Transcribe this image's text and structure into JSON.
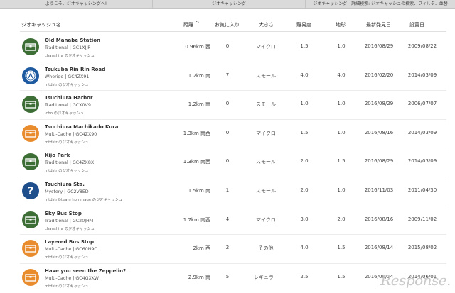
{
  "tabs": [
    {
      "label": "ようこそ、ジオキャッシングへ!"
    },
    {
      "label": "ジオキャッシング"
    },
    {
      "label": "ジオキャッシング - 詳細検索: ジオキャッシュの検索、フィルタ、並替"
    }
  ],
  "columns": {
    "name": "ジオキャッシュ名",
    "distance": "距離",
    "sort_arrow": "^",
    "favorites": "お気に入り",
    "size": "大きさ",
    "difficulty": "難易度",
    "terrain": "地形",
    "last_found": "最新発見日",
    "placed": "設置日"
  },
  "rows": [
    {
      "name": "Old Manabe Station",
      "type": "Traditional | GC1XJJP",
      "owner": "chanshira のジオキャッシュ",
      "distance": "0.96km 西",
      "favorites": "0",
      "size": "マイクロ",
      "difficulty": "1.5",
      "terrain": "1.0",
      "last_found": "2016/08/29",
      "placed": "2009/08/22",
      "icon": "traditional-icon",
      "icon_color": "#3d6e35"
    },
    {
      "name": "Tsukuba Rin Rin Road",
      "type": "Wherigo | GC4ZX91",
      "owner": "mtdstr のジオキャッシュ",
      "distance": "1.2km 南",
      "favorites": "7",
      "size": "スモール",
      "difficulty": "4.0",
      "terrain": "4.0",
      "last_found": "2016/02/20",
      "placed": "2014/03/09",
      "icon": "wherigo-icon",
      "icon_color": "#1e5aa0"
    },
    {
      "name": "Tsuchiura Harbor",
      "type": "Traditional | GCX0V9",
      "owner": "icho のジオキャッシュ",
      "distance": "1.2km 南",
      "favorites": "0",
      "size": "スモール",
      "difficulty": "1.0",
      "terrain": "1.0",
      "last_found": "2016/08/29",
      "placed": "2006/07/07",
      "icon": "traditional-icon",
      "icon_color": "#3d6e35"
    },
    {
      "name": "Tsuchiura Machikado Kura",
      "type": "Multi-Cache | GC4ZX90",
      "owner": "mtdstr のジオキャッシュ",
      "distance": "1.3km 南西",
      "favorites": "0",
      "size": "マイクロ",
      "difficulty": "1.5",
      "terrain": "1.0",
      "last_found": "2016/08/16",
      "placed": "2014/03/09",
      "icon": "multi-cache-icon",
      "icon_color": "#e98c2e"
    },
    {
      "name": "Kijo Park",
      "type": "Traditional | GC4ZX8X",
      "owner": "mtdstr のジオキャッシュ",
      "distance": "1.3km 南西",
      "favorites": "0",
      "size": "スモール",
      "difficulty": "2.0",
      "terrain": "1.5",
      "last_found": "2016/08/29",
      "placed": "2014/03/09",
      "icon": "traditional-icon",
      "icon_color": "#3d6e35"
    },
    {
      "name": "Tsuchiura Sta.",
      "type": "Mystery | GC2V8ED",
      "owner": "mtdstr@team hommage のジオキャッシュ",
      "distance": "1.5km 南",
      "favorites": "1",
      "size": "スモール",
      "difficulty": "2.0",
      "terrain": "1.0",
      "last_found": "2016/11/03",
      "placed": "2011/04/30",
      "icon": "mystery-icon",
      "icon_color": "#1e4f8c"
    },
    {
      "name": "Sky Bus Stop",
      "type": "Traditional | GC20JHM",
      "owner": "chanshira のジオキャッシュ",
      "distance": "1.7km 南西",
      "favorites": "4",
      "size": "マイクロ",
      "difficulty": "3.0",
      "terrain": "2.0",
      "last_found": "2016/08/16",
      "placed": "2009/11/02",
      "icon": "traditional-icon",
      "icon_color": "#3d6e35"
    },
    {
      "name": "Layered Bus Stop",
      "type": "Multi-Cache | GC60N9C",
      "owner": "mtdstr のジオキャッシュ",
      "distance": "2km 西",
      "favorites": "2",
      "size": "その他",
      "difficulty": "4.0",
      "terrain": "1.5",
      "last_found": "2016/08/14",
      "placed": "2015/08/02",
      "icon": "multi-cache-icon",
      "icon_color": "#e98c2e"
    },
    {
      "name": "Have you seen the Zeppelin?",
      "type": "Multi-Cache | GC4GXKW",
      "owner": "mtdstr のジオキャッシュ",
      "distance": "2.9km 南",
      "favorites": "5",
      "size": "レギュラー",
      "difficulty": "2.5",
      "terrain": "1.5",
      "last_found": "2016/08/14",
      "placed": "2014/06/01",
      "icon": "multi-cache-icon",
      "icon_color": "#e98c2e"
    }
  ],
  "watermark": "Response."
}
